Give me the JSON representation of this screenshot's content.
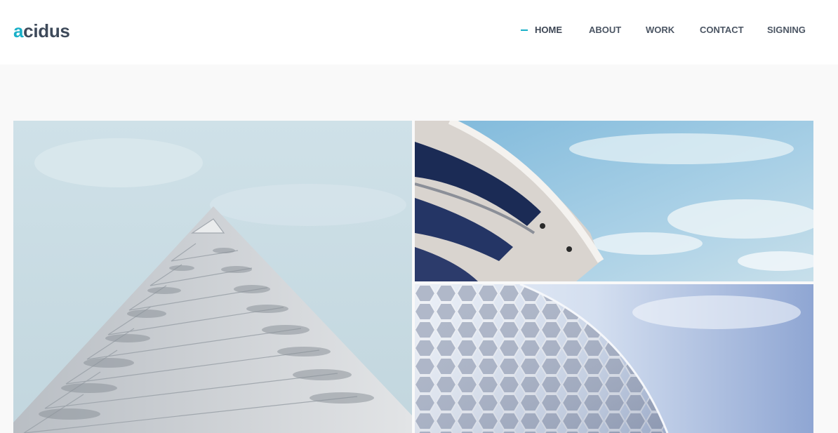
{
  "brand": {
    "logo_first": "a",
    "logo_rest": "cidus",
    "accent_color": "#1ab0c8",
    "text_color": "#3e4a5a"
  },
  "nav": {
    "items": [
      {
        "label": "HOME",
        "active": true
      },
      {
        "label": "ABOUT",
        "active": false
      },
      {
        "label": "WORK",
        "active": false
      },
      {
        "label": "CONTACT",
        "active": false
      },
      {
        "label": "SIGNING",
        "active": false
      }
    ]
  },
  "gallery": {
    "tiles": [
      {
        "name": "stepped-tower-photo"
      },
      {
        "name": "curved-building-sky-photo"
      },
      {
        "name": "hexagon-dome-photo"
      }
    ]
  }
}
